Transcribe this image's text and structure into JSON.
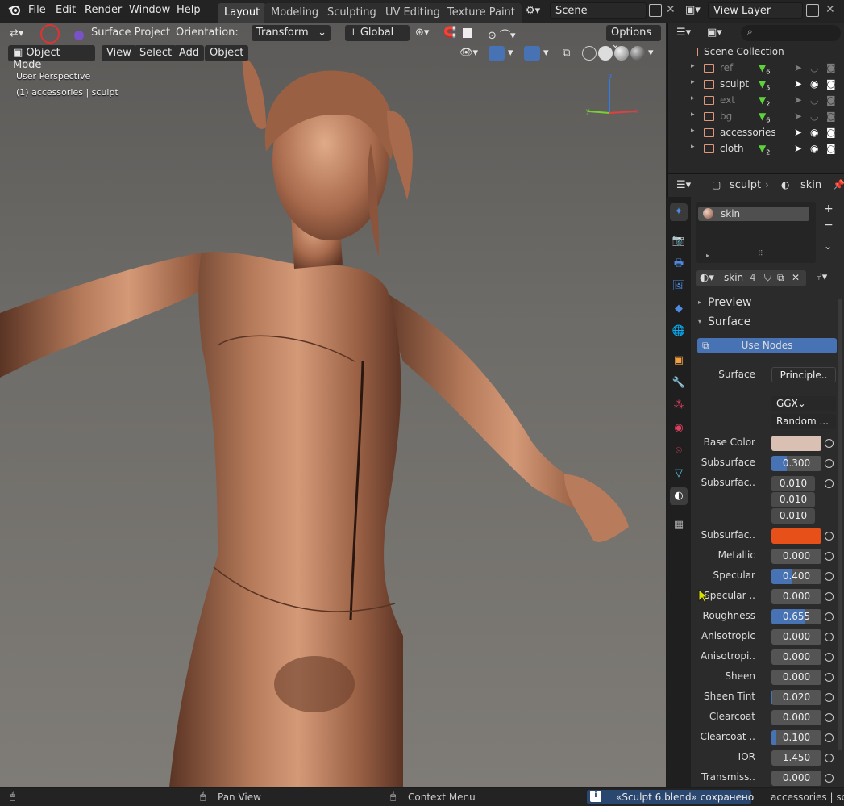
{
  "menu": [
    "File",
    "Edit",
    "Render",
    "Window",
    "Help"
  ],
  "workspaces": [
    {
      "label": "Layout",
      "active": true
    },
    {
      "label": "Modeling",
      "active": false
    },
    {
      "label": "Sculpting",
      "active": false
    },
    {
      "label": "UV Editing",
      "active": false
    },
    {
      "label": "Texture Paint",
      "active": false
    }
  ],
  "scene": {
    "name": "Scene"
  },
  "view_layer": {
    "name": "View Layer"
  },
  "tool_header": {
    "tool_name": "Surface Project",
    "orientation_label": "Orientation:",
    "orientation_value": "Transform",
    "transform_space": "Global",
    "options": "Options"
  },
  "viewport_header": {
    "mode": "Object Mode",
    "menus": [
      "View",
      "Select",
      "Add",
      "Object"
    ]
  },
  "viewport_overlay": {
    "perspective": "User Perspective",
    "object_info": "(1) accessories | sculpt"
  },
  "outliner": {
    "root": "Scene Collection",
    "collections": [
      {
        "name": "ref",
        "badge": "6",
        "dim": true
      },
      {
        "name": "sculpt",
        "badge": "5",
        "dim": false
      },
      {
        "name": "ext",
        "badge": "2",
        "dim": true
      },
      {
        "name": "bg",
        "badge": "6",
        "dim": true
      },
      {
        "name": "accessories",
        "badge": "",
        "dim": false
      },
      {
        "name": "cloth",
        "badge": "2",
        "dim": false
      }
    ]
  },
  "properties": {
    "breadcrumb_object": "sculpt",
    "breadcrumb_material": "skin",
    "slot_name": "skin",
    "material_name": "skin",
    "user_count": "4",
    "panel_preview": "Preview",
    "panel_surface": "Surface",
    "use_nodes": "Use Nodes",
    "surface_label": "Surface",
    "surface_value": "Principle..",
    "distribution": "GGX",
    "subsurface_method": "Random ...",
    "fields": [
      {
        "label": "Base Color",
        "type": "color",
        "color": "#d9c0b2"
      },
      {
        "label": "Subsurface",
        "value": "0.300",
        "fill": 0.3
      },
      {
        "label": "Subsurfac..",
        "type": "vector",
        "values": [
          "0.010",
          "0.010",
          "0.010"
        ]
      },
      {
        "label": "Subsurfac..",
        "type": "color",
        "color": "#e8501a"
      },
      {
        "label": "Metallic",
        "value": "0.000",
        "fill": 0
      },
      {
        "label": "Specular",
        "value": "0.400",
        "fill": 0.4
      },
      {
        "label": "Specular ..",
        "value": "0.000",
        "fill": 0
      },
      {
        "label": "Roughness",
        "value": "0.655",
        "fill": 0.655
      },
      {
        "label": "Anisotropic",
        "value": "0.000",
        "fill": 0
      },
      {
        "label": "Anisotropi..",
        "value": "0.000",
        "fill": 0
      },
      {
        "label": "Sheen",
        "value": "0.000",
        "fill": 0
      },
      {
        "label": "Sheen Tint",
        "value": "0.020",
        "fill": 0.02
      },
      {
        "label": "Clearcoat",
        "value": "0.000",
        "fill": 0
      },
      {
        "label": "Clearcoat ..",
        "value": "0.100",
        "fill": 0.1
      },
      {
        "label": "IOR",
        "value": "1.450",
        "fill": 0
      },
      {
        "label": "Transmiss..",
        "value": "0.000",
        "fill": 0
      }
    ]
  },
  "statusbar": {
    "pan": "Pan View",
    "context": "Context Menu",
    "message": "«Sculpt 6.blend» сохранено",
    "right": "accessories | scu"
  },
  "colors": {
    "accent": "#4772b3",
    "collection": "#e0957d",
    "active_tab": "#3d3d3d"
  }
}
